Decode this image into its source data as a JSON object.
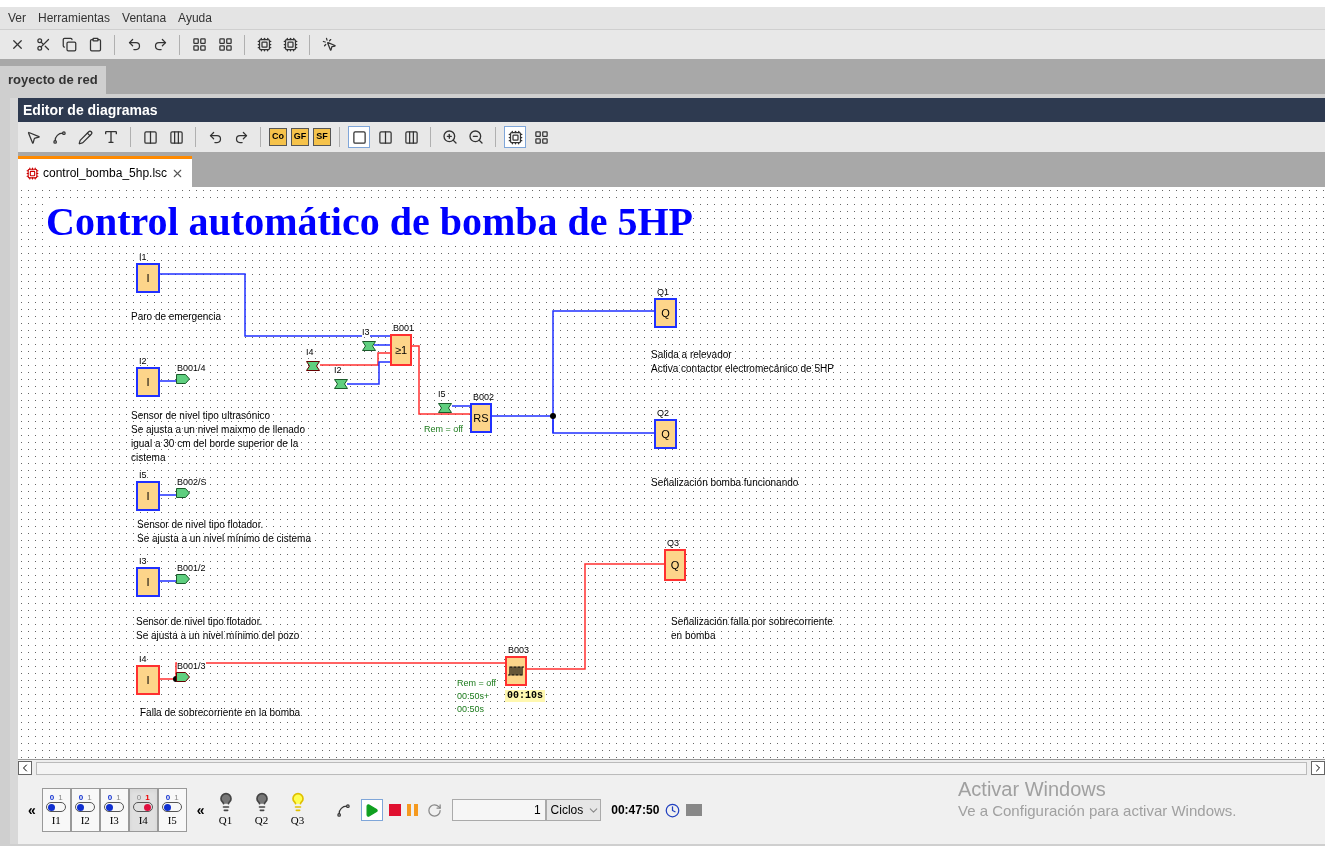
{
  "menu": [
    "Ver",
    "Herramientas",
    "Ventana",
    "Ayuda"
  ],
  "project_tab": "royecto de red",
  "editor": {
    "title": "Editor de diagramas",
    "toolbar_buttons": [
      "Co",
      "GF",
      "SF"
    ],
    "document_tab": "control_bomba_5hp.lsc"
  },
  "diagram": {
    "title": "Control automático de bomba de 5HP",
    "blocks": [
      {
        "name": "I1",
        "symbol": "I",
        "kind": "input",
        "on": false
      },
      {
        "name": "I2",
        "symbol": "I",
        "kind": "input",
        "on": false
      },
      {
        "name": "I5",
        "symbol": "I",
        "kind": "input",
        "on": false
      },
      {
        "name": "I3",
        "symbol": "I",
        "kind": "input",
        "on": false
      },
      {
        "name": "I4",
        "symbol": "I",
        "kind": "input",
        "on": true
      },
      {
        "name": "B001",
        "symbol": "≥1",
        "kind": "function",
        "on": true
      },
      {
        "name": "B002",
        "symbol": "RS",
        "kind": "function",
        "on": false
      },
      {
        "name": "Q1",
        "symbol": "Q",
        "kind": "output",
        "on": false
      },
      {
        "name": "Q2",
        "symbol": "Q",
        "kind": "output",
        "on": false
      },
      {
        "name": "Q3",
        "symbol": "Q",
        "kind": "output",
        "on": true
      },
      {
        "name": "B003",
        "kind": "pulse",
        "on": true
      }
    ],
    "connectors": [
      {
        "label": "B001/4",
        "on": false
      },
      {
        "label": "B002/S",
        "on": false
      },
      {
        "label": "B001/2",
        "on": false
      },
      {
        "label": "B001/3",
        "on": true
      },
      {
        "label": "I3",
        "on": false
      },
      {
        "label": "I4",
        "on": true
      },
      {
        "label": "I2",
        "on": false
      },
      {
        "label": "I5",
        "on": false
      }
    ],
    "parameters": [
      {
        "text": "Rem = off"
      },
      {
        "text": "Rem = off"
      },
      {
        "text": "00:50s+"
      },
      {
        "text": "00:50s"
      }
    ],
    "timer_value": "00:10s",
    "comments": [
      [
        "Paro de emergencia"
      ],
      [
        "Sensor de nivel tipo ultrasónico",
        "Se ajusta a un nivel maixmo de llenado",
        "igual a 30 cm del borde superior de la",
        "cistema"
      ],
      [
        "Sensor de nivel tipo flotador.",
        "Se ajusta a un nivel mínimo de cistema"
      ],
      [
        "Sensor de nivel tipo flotador.",
        "Se ajusta a un nivel mínimo del pozo"
      ],
      [
        "Falla de sobrecorriente en la bomba"
      ],
      [
        "Salida a relevador",
        "Activa contactor electromecánico de 5HP"
      ],
      [
        "Señalización bomba funcionando"
      ],
      [
        "Señalización falla por sobrecorriente",
        "en bomba"
      ]
    ]
  },
  "simulation": {
    "collapse_inputs": "«",
    "inputs": [
      {
        "name": "I1",
        "low": "0",
        "high": "1",
        "on": false
      },
      {
        "name": "I2",
        "low": "0",
        "high": "1",
        "on": false
      },
      {
        "name": "I3",
        "low": "0",
        "high": "1",
        "on": false
      },
      {
        "name": "I4",
        "low": "0",
        "high": "1",
        "on": true
      },
      {
        "name": "I5",
        "low": "0",
        "high": "1",
        "on": false
      }
    ],
    "collapse_outputs": "«",
    "outputs": [
      {
        "name": "Q1",
        "on": false
      },
      {
        "name": "Q2",
        "on": false
      },
      {
        "name": "Q3",
        "on": true
      }
    ],
    "cycles": "1",
    "cycle_unit": "Ciclos",
    "time": "00:47:50"
  },
  "activation_notice": {
    "title": "Activar Windows",
    "message": "Ve a Configuración para activar Windows."
  }
}
